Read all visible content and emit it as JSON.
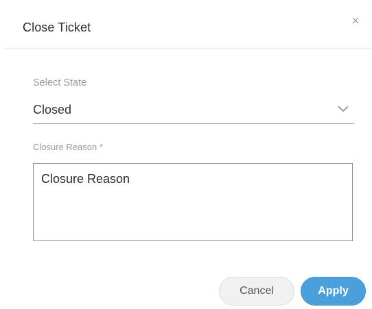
{
  "dialog": {
    "title": "Close Ticket",
    "close_icon": "close-icon"
  },
  "state_field": {
    "label": "Select State",
    "value": "Closed",
    "icon": "chevron-down-icon"
  },
  "reason_field": {
    "label": "Closure Reason *",
    "value": "Closure Reason"
  },
  "actions": {
    "cancel_label": "Cancel",
    "apply_label": "Apply"
  },
  "colors": {
    "accent": "#4ba0dc",
    "cancel_bg": "#f1f1f1",
    "label": "#9a9a9a"
  }
}
